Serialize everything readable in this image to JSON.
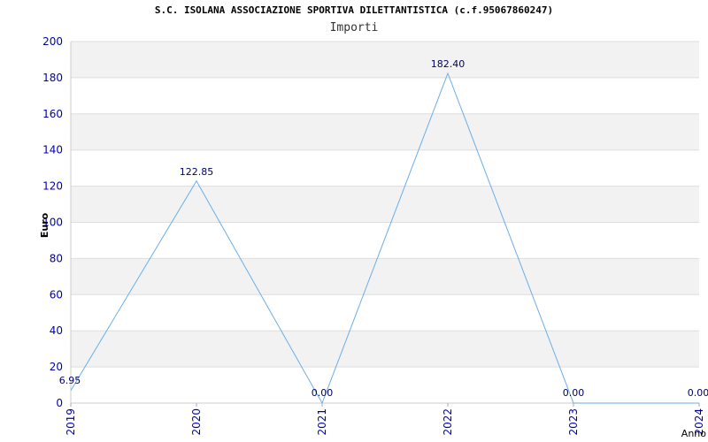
{
  "header": {
    "title": "S.C. ISOLANA ASSOCIAZIONE SPORTIVA DILETTANTISTICA (c.f.95067860247)",
    "subtitle": "Importi"
  },
  "chart_data": {
    "type": "line",
    "title": "S.C. ISOLANA ASSOCIAZIONE SPORTIVA DILETTANTISTICA (c.f.95067860247)",
    "subtitle": "Importi",
    "xlabel": "Anno",
    "ylabel": "Euro",
    "x": [
      "2019",
      "2020",
      "2021",
      "2022",
      "2023",
      "2024"
    ],
    "series": [
      {
        "values": [
          6.95,
          122.85,
          0.0,
          182.4,
          0.0,
          0.0
        ],
        "labels": [
          "6.95",
          "122.85",
          "0.00",
          "182.40",
          "0.00",
          "0.00"
        ]
      }
    ],
    "ylim": [
      0,
      200
    ],
    "yticks": [
      0,
      20,
      40,
      60,
      80,
      100,
      120,
      140,
      160,
      180,
      200
    ],
    "grid": true,
    "colors": {
      "line": "#6aaee6",
      "band_alt": "#f2f2f2",
      "band": "#ffffff",
      "gridline": "#dddddd",
      "tick_text": "#0000aa"
    }
  }
}
